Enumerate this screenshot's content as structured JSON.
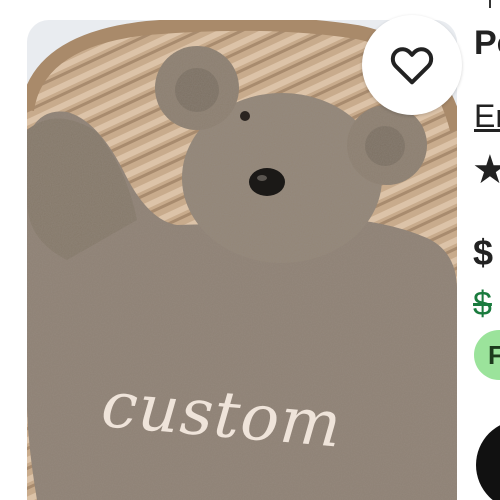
{
  "product_image": {
    "overlay_text": "custom"
  },
  "favorite_button": {
    "icon": "heart-outline-icon"
  },
  "listing_panel": {
    "title_fragment": "Po",
    "shop_fragment": "Er",
    "rating_icon": "star-icon",
    "price_fragment": "$",
    "original_price_fragment": "$",
    "badge_fragment": "F",
    "cta_color": "#111111"
  },
  "colors": {
    "sale_price": "#1a7b3e",
    "badge_bg": "#9be39b",
    "plush": "#8e8174",
    "wicker": "#c8ab8c"
  }
}
